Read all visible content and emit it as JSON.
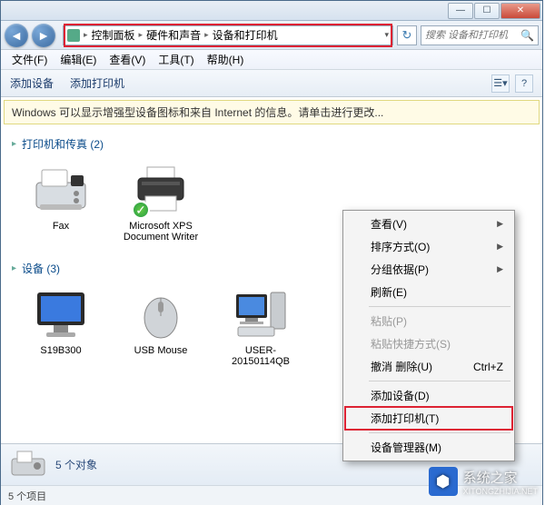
{
  "titlebar": {
    "min": "—",
    "max": "☐",
    "close": "✕"
  },
  "breadcrumb": {
    "items": [
      "控制面板",
      "硬件和声音",
      "设备和打印机"
    ]
  },
  "search": {
    "placeholder": "搜索 设备和打印机"
  },
  "menubar": {
    "file": "文件(F)",
    "edit": "编辑(E)",
    "view": "查看(V)",
    "tools": "工具(T)",
    "help": "帮助(H)"
  },
  "toolbar": {
    "add_device": "添加设备",
    "add_printer": "添加打印机"
  },
  "infobar": {
    "text": "Windows 可以显示增强型设备图标和来自 Internet 的信息。请单击进行更改..."
  },
  "groups": {
    "printers": {
      "title": "打印机和传真 (2)",
      "items": [
        "Fax",
        "Microsoft XPS Document Writer"
      ]
    },
    "devices": {
      "title": "设备 (3)",
      "items": [
        "S19B300",
        "USB Mouse",
        "USER-20150114QB"
      ]
    }
  },
  "context_menu": {
    "view": "查看(V)",
    "sort": "排序方式(O)",
    "group": "分组依据(P)",
    "refresh": "刷新(E)",
    "paste": "粘贴(P)",
    "paste_shortcut": "粘贴快捷方式(S)",
    "undo_delete": "撤消 删除(U)",
    "undo_key": "Ctrl+Z",
    "add_device": "添加设备(D)",
    "add_printer": "添加打印机(T)",
    "device_manager": "设备管理器(M)"
  },
  "details": {
    "count_label": "5 个对象"
  },
  "status": {
    "text": "5 个项目"
  },
  "watermark": {
    "text": "系统之家",
    "url": "XITONGZHIJIA.NET"
  }
}
